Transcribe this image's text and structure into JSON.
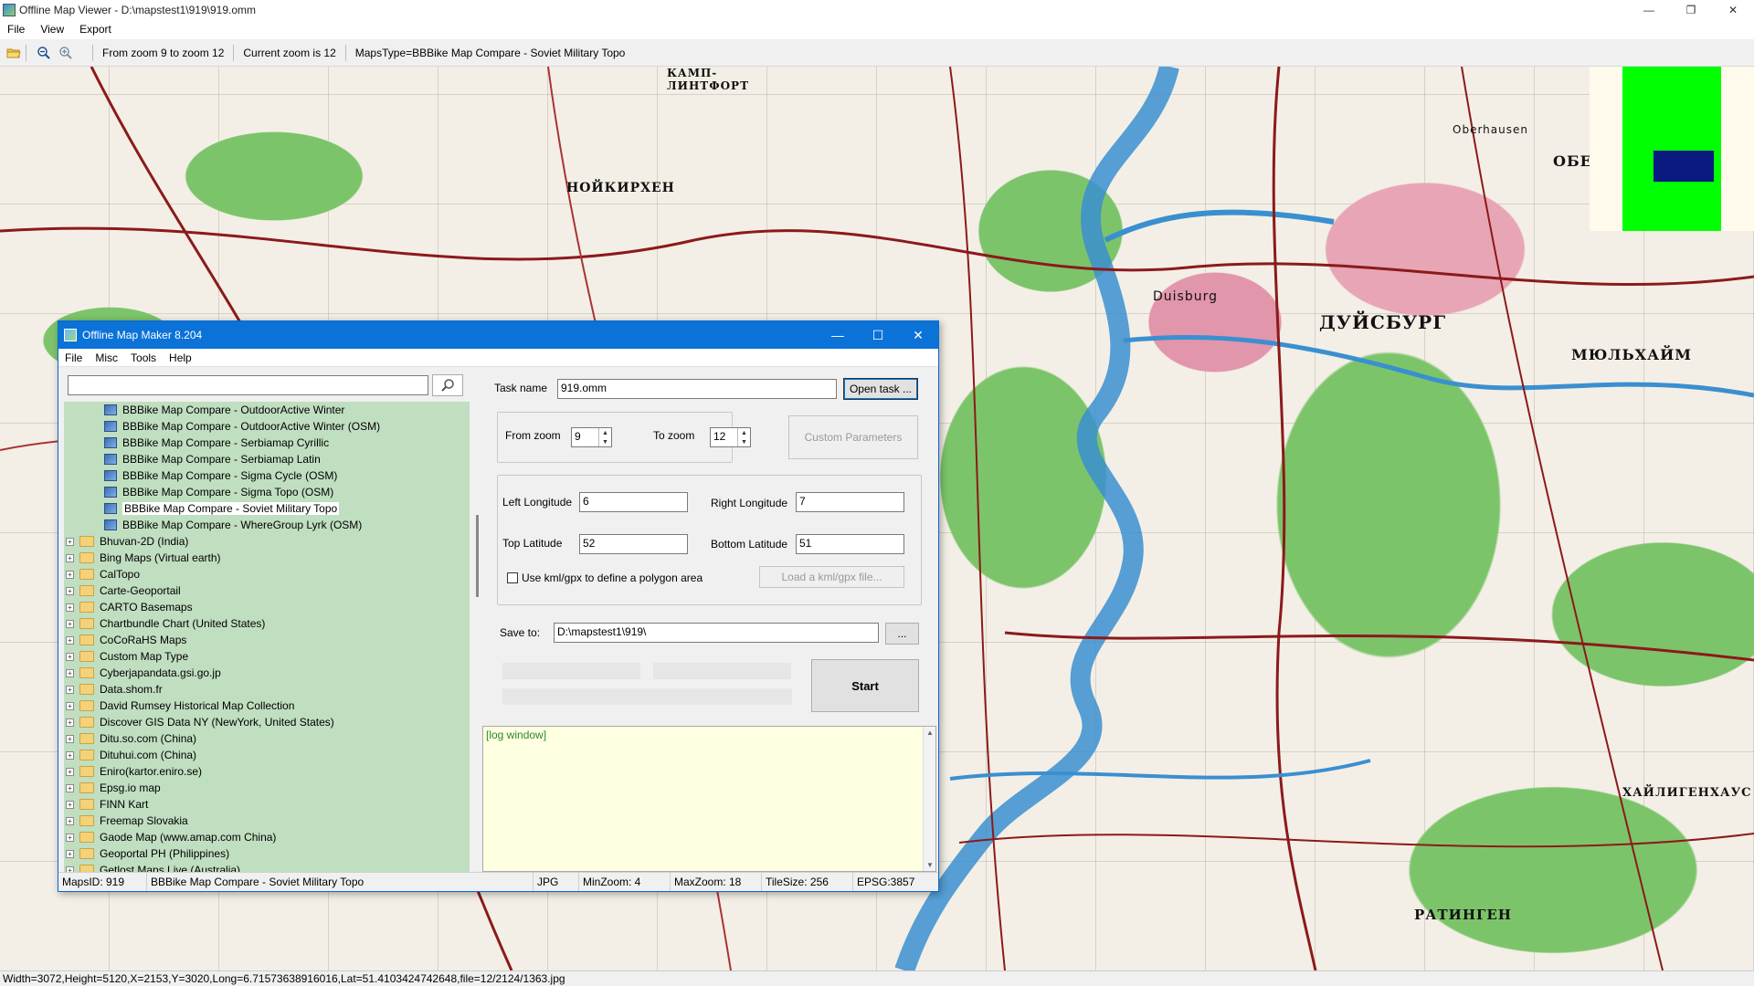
{
  "window": {
    "title": "Offline Map Viewer - D:\\mapstest1\\919\\919.omm",
    "min": "—",
    "max": "❐",
    "close": "✕"
  },
  "menu": [
    "File",
    "View",
    "Export"
  ],
  "toolbar": {
    "zoom_range": "From zoom 9 to zoom 12",
    "current_zoom": "Current zoom is 12",
    "maps_type": "MapsType=BBBike Map Compare - Soviet Military Topo"
  },
  "map_labels": {
    "l1": "КАМП-\nЛИНТФОРТ",
    "l2": "НОЙКИРХЕН",
    "l3": "Duisburg",
    "l4": "ДУЙСБУРГ",
    "l5": "МЮЛЬХАЙМ",
    "l6": "ОБЕРХАУЗЕ",
    "l7": "ХАЙЛИГЕНХАУС",
    "l8": "РАТИНГЕН",
    "l9": "Oberhausen"
  },
  "status": "Width=3072,Height=5120,X=2153,Y=3020,Long=6.71573638916016,Lat=51.4103424742648,file=12/2124/1363.jpg",
  "dialog": {
    "title": "Offline Map Maker 8.204",
    "min": "—",
    "max": "☐",
    "close": "✕",
    "menu": [
      "File",
      "Misc",
      "Tools",
      "Help"
    ],
    "search_placeholder": "",
    "tree": {
      "sub_items": [
        "BBBike Map Compare - OutdoorActive Winter",
        "BBBike Map Compare - OutdoorActive Winter (OSM)",
        "BBBike Map Compare - Serbiamap Cyrillic",
        "BBBike Map Compare - Serbiamap Latin",
        "BBBike Map Compare - Sigma Cycle (OSM)",
        "BBBike Map Compare - Sigma Topo (OSM)",
        "BBBike Map Compare - Soviet Military Topo",
        "BBBike Map Compare - WhereGroup Lyrk (OSM)"
      ],
      "selected_index": 6,
      "top_items": [
        "Bhuvan-2D (India)",
        "Bing Maps (Virtual earth)",
        "CalTopo",
        "Carte-Geoportail",
        "CARTO Basemaps",
        "Chartbundle Chart (United States)",
        "CoCoRaHS Maps",
        "Custom Map Type",
        "Cyberjapandata.gsi.go.jp",
        "Data.shom.fr",
        "David Rumsey Historical Map Collection",
        "Discover GIS Data NY (NewYork, United States)",
        "Ditu.so.com (China)",
        "Dituhui.com (China)",
        "Eniro(kartor.eniro.se)",
        "Epsg.io map",
        "FINN Kart",
        "Freemap Slovakia",
        "Gaode Map (www.amap.com China)",
        "Geoportal PH (Philippines)",
        "Getlost Maps Live (Australia)"
      ]
    },
    "task": {
      "label": "Task name",
      "value": "919.omm",
      "open_button": "Open task ..."
    },
    "zoom": {
      "from_label": "From zoom",
      "from_value": "9",
      "to_label": "To zoom",
      "to_value": "12",
      "custom_button": "Custom Parameters"
    },
    "coords": {
      "left_label": "Left Longitude",
      "left_value": "6",
      "right_label": "Right Longitude",
      "right_value": "7",
      "top_label": "Top Latitude",
      "top_value": "52",
      "bottom_label": "Bottom Latitude",
      "bottom_value": "51",
      "kml_label": "Use kml/gpx to define a polygon area",
      "kml_checked": false,
      "load_button": "Load a kml/gpx file..."
    },
    "save": {
      "label": "Save to:",
      "value": "D:\\mapstest1\\919\\",
      "browse": "..."
    },
    "start_button": "Start",
    "log_text": "[log window]",
    "status": {
      "maps_id": "MapsID: 919",
      "name": "BBBike Map Compare - Soviet Military Topo",
      "format": "JPG",
      "min_zoom": "MinZoom: 4",
      "max_zoom": "MaxZoom: 18",
      "tile_size": "TileSize: 256",
      "epsg": "EPSG:3857"
    }
  },
  "colors": {
    "title_blue": "#0b72d8",
    "tree_bg": "#c0dec0",
    "log_bg": "#ffffe1",
    "minimap_green": "#00ff00",
    "minimap_blue": "#0b1a80"
  }
}
